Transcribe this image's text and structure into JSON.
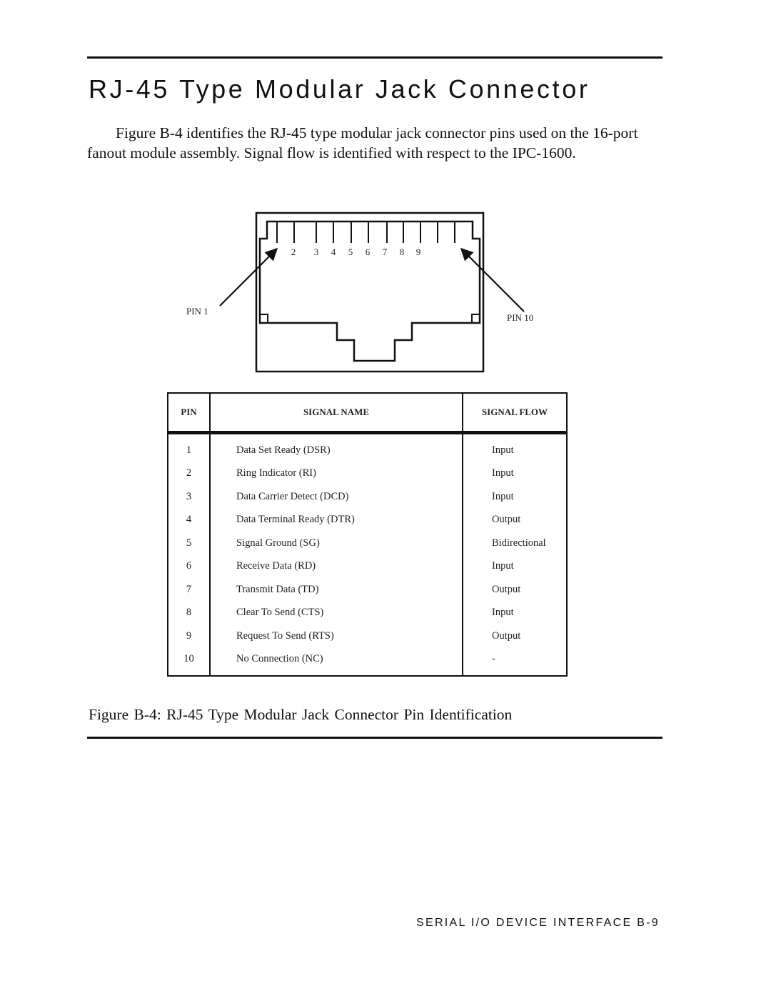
{
  "page": {
    "title": "RJ-45 Type Modular Jack Connector",
    "intro": "Figure B-4 identifies the RJ-45 type modular jack connector pins used on the 16-port fanout module assembly. Signal flow is identified with respect to the IPC-1600.",
    "caption": "Figure B-4:  RJ-45 Type Modular Jack Connector Pin Identification",
    "footer": "SERIAL I/O DEVICE INTERFACE  B-9"
  },
  "diagram": {
    "pin_numbers": [
      "2",
      "3",
      "4",
      "5",
      "6",
      "7",
      "8",
      "9"
    ],
    "label_pin1": "PIN 1",
    "label_pin10": "PIN 10"
  },
  "table": {
    "headers": {
      "pin": "PIN",
      "name": "SIGNAL NAME",
      "flow": "SIGNAL FLOW"
    },
    "rows": [
      {
        "pin": "1",
        "name": "Data Set Ready (DSR)",
        "flow": "Input"
      },
      {
        "pin": "2",
        "name": "Ring Indicator (RI)",
        "flow": "Input"
      },
      {
        "pin": "3",
        "name": "Data Carrier Detect (DCD)",
        "flow": "Input"
      },
      {
        "pin": "4",
        "name": "Data Terminal Ready (DTR)",
        "flow": "Output"
      },
      {
        "pin": "5",
        "name": "Signal Ground (SG)",
        "flow": "Bidirectional"
      },
      {
        "pin": "6",
        "name": "Receive Data (RD)",
        "flow": "Input"
      },
      {
        "pin": "7",
        "name": "Transmit Data (TD)",
        "flow": "Output"
      },
      {
        "pin": "8",
        "name": "Clear To Send (CTS)",
        "flow": "Input"
      },
      {
        "pin": "9",
        "name": "Request To Send (RTS)",
        "flow": "Output"
      },
      {
        "pin": "10",
        "name": "No Connection (NC)",
        "flow": "-"
      }
    ]
  }
}
